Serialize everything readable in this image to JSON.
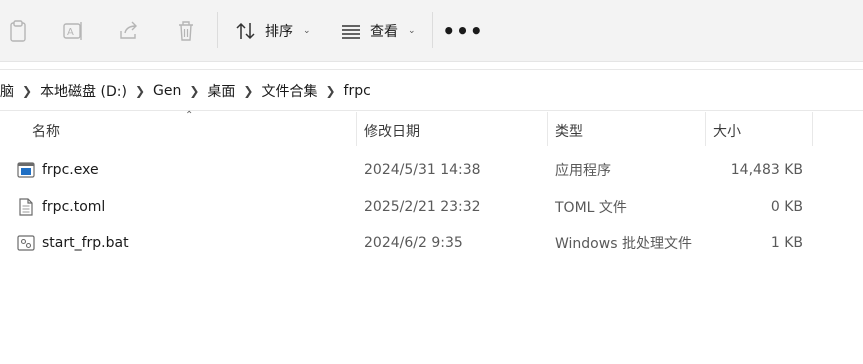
{
  "toolbar": {
    "sort_label": "排序",
    "view_label": "查看",
    "more_label": "•••"
  },
  "breadcrumb": [
    "脑",
    "本地磁盘 (D:)",
    "Gen",
    "桌面",
    "文件合集",
    "frpc"
  ],
  "columns": {
    "name": "名称",
    "modified": "修改日期",
    "type": "类型",
    "size": "大小"
  },
  "files": [
    {
      "name": "frpc.exe",
      "modified": "2024/5/31 14:38",
      "type": "应用程序",
      "size": "14,483 KB",
      "icon": "exe-icon"
    },
    {
      "name": "frpc.toml",
      "modified": "2025/2/21 23:32",
      "type": "TOML 文件",
      "size": "0 KB",
      "icon": "text-file-icon"
    },
    {
      "name": "start_frp.bat",
      "modified": "2024/6/2 9:35",
      "type": "Windows 批处理文件",
      "size": "1 KB",
      "icon": "batch-file-icon"
    }
  ]
}
